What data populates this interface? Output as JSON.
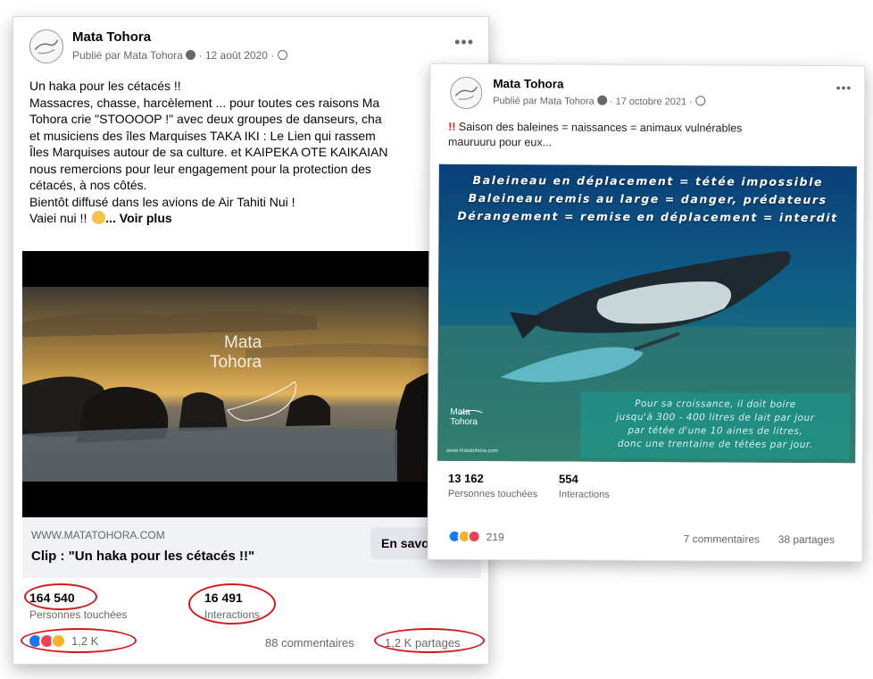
{
  "post1": {
    "page_name": "Mata Tohora",
    "meta": "Publié par Mata Tohora",
    "date": "12 août 2020",
    "lines": [
      "Un haka pour les cétacés !!",
      "Massacres, chasse, harcèlement ... pour toutes ces raisons Ma",
      "Tohora crie \"STOOOOP !\" avec deux groupes de danseurs, cha",
      "et musiciens des îles Marquises TAKA IKI : Le Lien  qui rassem",
      "Îles Marquises autour de sa culture. et KAIPEKA OTE KAIKAIAN",
      "nous remercions pour leur engagement pour la protection des",
      "cétacés, à nos côtés.",
      "Bientôt diffusé dans les avions de Air Tahiti Nui !"
    ],
    "last_line": "Vaiei nui !!",
    "see_more": "... Voir plus",
    "video_watermark": [
      "Mata",
      "Tohora"
    ],
    "link_domain": "WWW.MATATOHORA.COM",
    "link_title": "Clip : \"Un haka pour les cétacés !!\"",
    "learn_more": "En savoir plus",
    "reach_value": "164 540",
    "reach_label": "Personnes touchées",
    "interactions_value": "16 491",
    "interactions_label": "Interactions",
    "reactions_count": "1,2 K",
    "comments": "88 commentaires",
    "shares": "1,2 K partages"
  },
  "post2": {
    "page_name": "Mata Tohora",
    "meta": "Publié par Mata Tohora",
    "date": "17 octobre 2021",
    "text_line1": "Saison des baleines = naissances = animaux vulnérables",
    "text_line2": "mauruuru pour eux...",
    "bang": "!!",
    "image_lines": [
      "Baleineau en déplacement = tétée impossible",
      "Baleineau remis au large = danger, prédateurs",
      "Dérangement = remise en déplacement = interdit"
    ],
    "image_box": [
      "Pour sa croissance, il doit boire",
      "jusqu'à 300 - 400 litres de lait par jour",
      "par tétée d'une 10 aines de litres,",
      "donc une trentaine de tétées par jour."
    ],
    "image_watermark": [
      "Mata",
      "Tohora"
    ],
    "image_url": "www.matatohora.com",
    "reach_value": "13 162",
    "reach_label": "Personnes touchées",
    "interactions_value": "554",
    "interactions_label": "Interactions",
    "reactions_count": "219",
    "comments": "7 commentaires",
    "shares": "38 partages"
  },
  "colors": {
    "annotation_red": "#d31a1a",
    "like_blue": "#1877f2",
    "heart_red": "#f33e58",
    "care_yellow": "#f7b125"
  },
  "icons": [
    "page-logo-icon",
    "verified-icon",
    "globe-icon",
    "more-options-icon",
    "like-reaction-icon",
    "love-reaction-icon",
    "care-reaction-icon"
  ]
}
